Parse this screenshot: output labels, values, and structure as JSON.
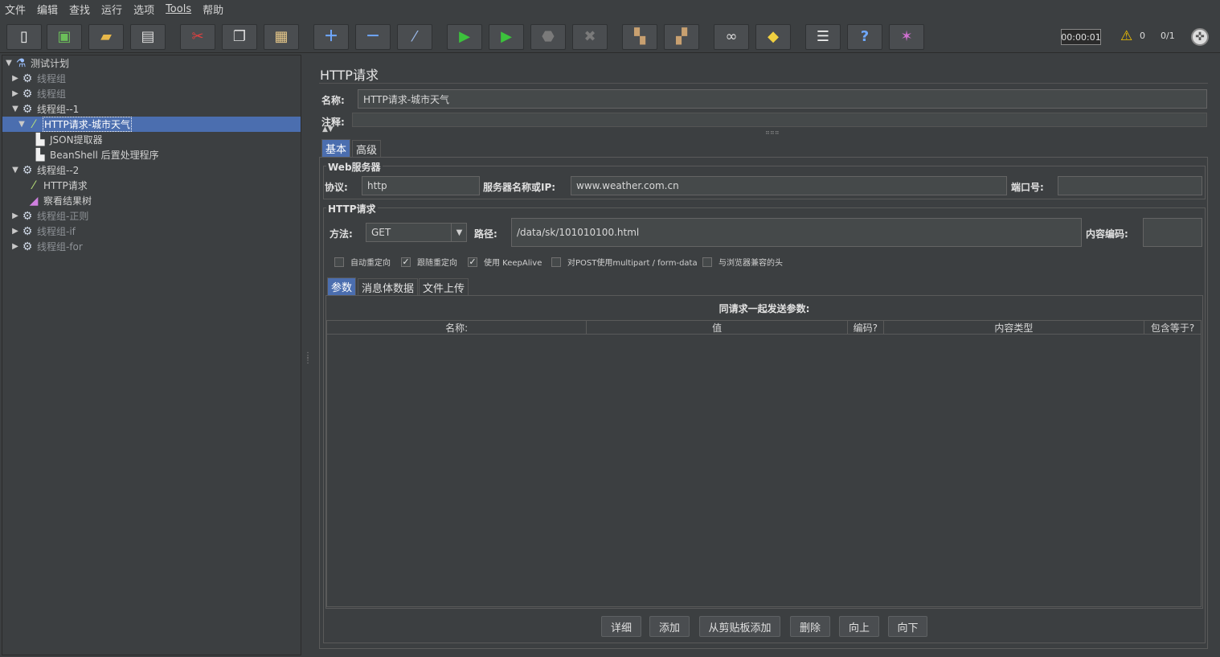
{
  "menu": [
    "文件",
    "编辑",
    "查找",
    "运行",
    "选项",
    "Tools",
    "帮助"
  ],
  "toolbar": {
    "timer": "00:00:01",
    "warning_count": "0",
    "thread_count": "0/1"
  },
  "tree": [
    {
      "label": "测试计划",
      "icon": "flask-icon"
    },
    {
      "label": "线程组",
      "icon": "gear-icon"
    },
    {
      "label": "线程组",
      "icon": "gear-icon"
    },
    {
      "label": "线程组--1",
      "icon": "gear-icon"
    },
    {
      "label": "HTTP请求-城市天气",
      "icon": "pipette-icon"
    },
    {
      "label": "JSON提取器",
      "icon": "document-icon"
    },
    {
      "label": "BeanShell 后置处理程序",
      "icon": "document-icon"
    },
    {
      "label": "线程组--2",
      "icon": "gear-icon"
    },
    {
      "label": "HTTP请求",
      "icon": "pipette-icon"
    },
    {
      "label": "察看结果树",
      "icon": "chart-icon"
    },
    {
      "label": "线程组-正则",
      "icon": "gear-icon"
    },
    {
      "label": "线程组-if",
      "icon": "gear-icon"
    },
    {
      "label": "线程组-for",
      "icon": "gear-icon"
    }
  ],
  "panel": {
    "title": "HTTP请求",
    "name_label": "名称:",
    "name_value": "HTTP请求-城市天气",
    "comment_label": "注释:",
    "comment_value": ""
  },
  "tabs": {
    "basic": "基本",
    "advanced": "高级"
  },
  "web_server": {
    "title": "Web服务器",
    "protocol_label": "协议:",
    "protocol_value": "http",
    "server_label": "服务器名称或IP:",
    "server_value": "www.weather.com.cn",
    "port_label": "端口号:",
    "port_value": ""
  },
  "http_request": {
    "title": "HTTP请求",
    "method_label": "方法:",
    "method_value": "GET",
    "path_label": "路径:",
    "path_value": "/data/sk/101010100.html",
    "encoding_label": "内容编码:",
    "encoding_value": ""
  },
  "checkboxes": [
    {
      "label": "自动重定向",
      "checked": false
    },
    {
      "label": "跟随重定向",
      "checked": true
    },
    {
      "label": "使用 KeepAlive",
      "checked": true
    },
    {
      "label": "对POST使用multipart / form-data",
      "checked": false
    },
    {
      "label": "与浏览器兼容的头",
      "checked": false
    }
  ],
  "sub_tabs": {
    "params": "参数",
    "body": "消息体数据",
    "files": "文件上传"
  },
  "params_table": {
    "caption": "同请求一起发送参数:",
    "columns": [
      "名称:",
      "值",
      "编码?",
      "内容类型",
      "包含等于?"
    ]
  },
  "buttons": {
    "detail": "详细",
    "add": "添加",
    "add_clipboard": "从剪贴板添加",
    "delete": "删除",
    "up": "向上",
    "down": "向下"
  }
}
